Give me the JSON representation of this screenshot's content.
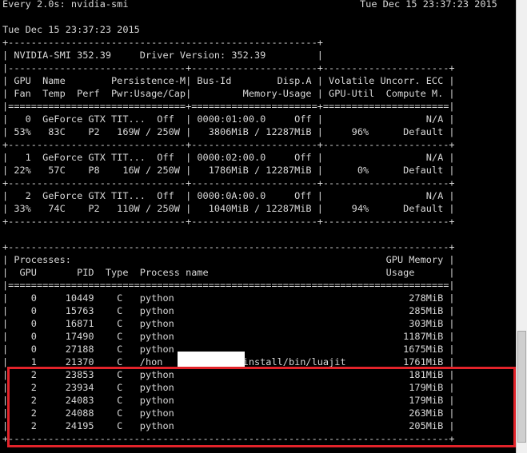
{
  "header": {
    "watch_command": "Every 2.0s: nvidia-smi",
    "watch_time": "Tue Dec 15 23:37:23 2015"
  },
  "timestamp": "Tue Dec 15 23:37:23 2015",
  "summary_table": {
    "border_top": "+------------------------------------------------------+",
    "smi_version_line": "| NVIDIA-SMI 352.39     Driver Version: 352.39         |",
    "divider": "|-------------------------------+----------------------+----------------------+",
    "header_row_1": "| GPU  Name        Persistence-M| Bus-Id        Disp.A | Volatile Uncorr. ECC |",
    "header_row_2": "| Fan  Temp  Perf  Pwr:Usage/Cap|         Memory-Usage | GPU-Util  Compute M. |",
    "header_sep": "|===============================+======================+======================|",
    "gpu_sep": "+-------------------------------+----------------------+----------------------+",
    "gpus": [
      {
        "row1": "|   0  GeForce GTX TIT...  Off  | 0000:01:00.0     Off |                  N/A |",
        "row2": "| 53%   83C    P2   169W / 250W |   3806MiB / 12287MiB |     96%      Default |"
      },
      {
        "row1": "|   1  GeForce GTX TIT...  Off  | 0000:02:00.0     Off |                  N/A |",
        "row2": "| 22%   57C    P8    16W / 250W |   1786MiB / 12287MiB |      0%      Default |"
      },
      {
        "row1": "|   2  GeForce GTX TIT...  Off  | 0000:0A:00.0     Off |                  N/A |",
        "row2": "| 33%   74C    P2   110W / 250W |   1040MiB / 12287MiB |     94%      Default |"
      }
    ]
  },
  "processes_table": {
    "border": "+-----------------------------------------------------------------------------+",
    "title_row": "| Processes:                                                       GPU Memory |",
    "header_row": "|  GPU       PID  Type  Process name                               Usage      |",
    "header_sep": "|=============================================================================|",
    "rows": [
      "|    0     10449    C   python                                         278MiB |",
      "|    0     15763    C   python                                         285MiB |",
      "|    0     16871    C   python                                         303MiB |",
      "|    0     17490    C   python                                        1187MiB |",
      "|    0     27188    C   python                                        1675MiB |",
      "|    1     21370    C   /hon          rch/install/bin/luajit          1761MiB |",
      "|    2     23853    C   python                                         181MiB |",
      "|    2     23934    C   python                                         179MiB |",
      "|    2     24083    C   python                                         179MiB |",
      "|    2     24088    C   python                                         263MiB |",
      "|    2     24195    C   python                                         205MiB |"
    ]
  },
  "colors": {
    "background": "#000000",
    "text": "#d8d8d8",
    "highlight_border": "#e2232a"
  }
}
